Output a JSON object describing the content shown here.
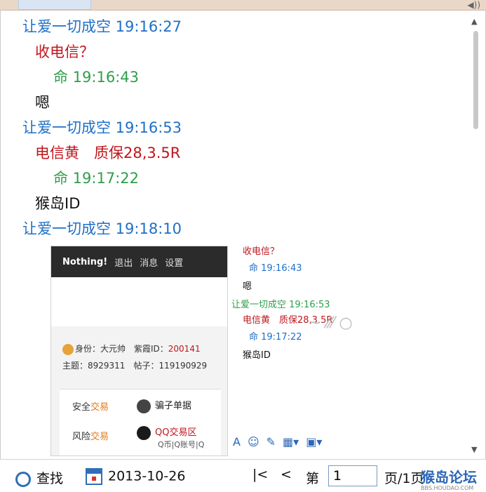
{
  "messages": [
    {
      "type": "header-blue",
      "text": "让爱一切成空 19:16:27"
    },
    {
      "type": "red",
      "text": "收电信？"
    },
    {
      "type": "header-green",
      "text": "命 19:16:43"
    },
    {
      "type": "black",
      "text": "嗯"
    },
    {
      "type": "header-blue",
      "text": "让爱一切成空 19:16:53"
    },
    {
      "type": "red",
      "text": "电信黄　质保28,3.5R"
    },
    {
      "type": "header-green",
      "text": "命 19:17:22"
    },
    {
      "type": "black",
      "text": "猴岛ID"
    },
    {
      "type": "header-blue",
      "text": "让爱一切成空 19:18:10"
    }
  ],
  "embedded": {
    "nav": [
      "Nothing!",
      "退出",
      "消息",
      "设置"
    ],
    "info1": "身份：大元帅　紫霞ID：",
    "info1_num": "200141",
    "info2": "主题：8929311　帖子：119190929",
    "menu1_a": "安全",
    "menu1_b": "交易",
    "menu2_a": "风险",
    "menu2_b": "交易",
    "menu_item1": "骗子单据",
    "menu_item2": "QQ交易区",
    "menu_sub": "Q币|Q账号|Q",
    "mini_lines": [
      {
        "cls": "red",
        "text": "收电信？"
      },
      {
        "cls": "blue",
        "text": "命 19:16:43"
      },
      {
        "cls": "black",
        "text": "嗯"
      },
      {
        "cls": "green",
        "text": "让爱一切成空 19:16:53"
      },
      {
        "cls": "red",
        "text": "电信黄　质保28,3.5R"
      },
      {
        "cls": "blue",
        "text": "命 19:17:22"
      },
      {
        "cls": "black",
        "text": "猴岛ID"
      }
    ]
  },
  "bottom": {
    "search_label": "查找",
    "date": "2013-10-26",
    "first_icon": "|<",
    "prev_icon": "<",
    "page_prefix": "第",
    "page_value": "1",
    "page_suffix": "页/1页"
  },
  "watermark": {
    "main": "猴岛论坛",
    "sub": "BBS.HOUDAO.COM"
  },
  "colors": {
    "blue": "#1e6fc7",
    "green": "#2f9e4a",
    "red": "#c0161c"
  }
}
